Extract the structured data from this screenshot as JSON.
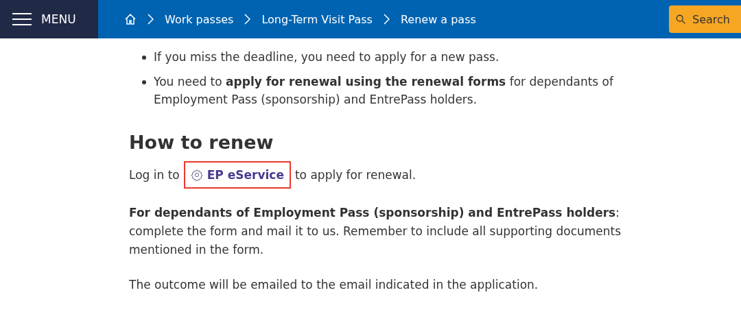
{
  "header": {
    "menu_label": "MENU",
    "breadcrumbs": [
      "Work passes",
      "Long-Term Visit Pass",
      "Renew a pass"
    ],
    "search_label": "Search"
  },
  "bullets": [
    "If you miss the deadline, you need to apply for a new pass.",
    "You need to **apply for renewal using the renewal forms** for dependants of Employment Pass (sponsorship) and EntrePass holders."
  ],
  "heading": "How to renew",
  "login_line": {
    "before": "Log in to",
    "link": "EP eService",
    "after": "to apply for renewal.",
    "highlighted": true
  },
  "paragraphs": [
    "**For dependants of Employment Pass (sponsorship) and EntrePass holders**: complete the form and mail it to us. Remember to include all supporting documents mentioned in the form.",
    "The outcome will be emailed to the email indicated in the application."
  ]
}
